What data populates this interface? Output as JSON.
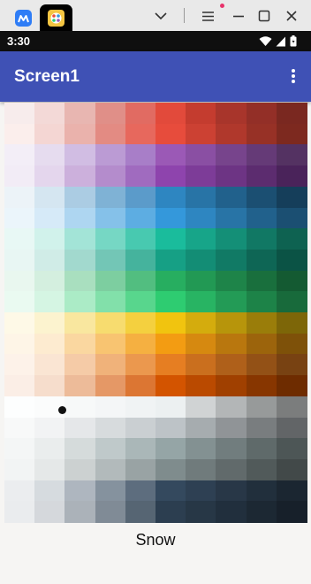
{
  "window": {
    "tabs": [
      {
        "name": "app-tab",
        "icon": "m-logo-icon",
        "active": false
      },
      {
        "name": "palette-tab",
        "icon": "palette-icon",
        "active": true
      }
    ],
    "controls": [
      "chevron-down-icon",
      "menu-icon",
      "minimize-icon",
      "maximize-icon",
      "close-icon"
    ]
  },
  "status_bar": {
    "time": "3:30"
  },
  "app_bar": {
    "title": "Screen1"
  },
  "selected_color_name": "Snow",
  "palette": {
    "rows": [
      [
        "#f7ecec",
        "#f3d9d7",
        "#e8b6b1",
        "#e08f88",
        "#e16b62",
        "#e24a3b",
        "#c43c2f",
        "#a8352b",
        "#932f27",
        "#7a2820"
      ],
      [
        "#fbeeec",
        "#f4d6d3",
        "#eab2ac",
        "#e38b83",
        "#e7685d",
        "#e74c3c",
        "#cc4133",
        "#b0382c",
        "#973126",
        "#7d291f"
      ],
      [
        "#f3eef7",
        "#e6dcef",
        "#d1bde3",
        "#bb9bd4",
        "#a87ec8",
        "#9b59b6",
        "#8a4fa3",
        "#77448c",
        "#653a77",
        "#543262"
      ],
      [
        "#f2ecf6",
        "#e4d6ed",
        "#ccb0dc",
        "#b48ccc",
        "#a06bbf",
        "#8e44ad",
        "#7d3c98",
        "#6d3484",
        "#5c2c6f",
        "#4a235a"
      ],
      [
        "#ecf3f8",
        "#d5e6f1",
        "#abcce3",
        "#7fb2d5",
        "#5b9bca",
        "#2e86c1",
        "#2874a6",
        "#21618c",
        "#1b4f72",
        "#153e5a"
      ],
      [
        "#ebf5fb",
        "#d6eaf8",
        "#aed6f1",
        "#85c1e9",
        "#5dade2",
        "#3498db",
        "#2e86c1",
        "#2874a6",
        "#21618c",
        "#1b4f72"
      ],
      [
        "#e8f8f5",
        "#d1f2eb",
        "#a3e4d7",
        "#76d7c4",
        "#48c9b0",
        "#1abc9c",
        "#17a589",
        "#148f77",
        "#117864",
        "#0e6251"
      ],
      [
        "#e8f6f3",
        "#d0ece7",
        "#a2d9ce",
        "#73c6b6",
        "#45b39d",
        "#16a085",
        "#138d75",
        "#117a65",
        "#0e6655",
        "#0b5345"
      ],
      [
        "#e9f7ef",
        "#d4efdf",
        "#a9dfbf",
        "#7dcea0",
        "#52be80",
        "#27ae60",
        "#229954",
        "#1e8449",
        "#196f3d",
        "#145a32"
      ],
      [
        "#eafaf1",
        "#d5f5e3",
        "#abebc6",
        "#82e0aa",
        "#58d68d",
        "#2ecc71",
        "#28b463",
        "#239b56",
        "#1d8348",
        "#186a3b"
      ],
      [
        "#fef9e7",
        "#fcf3cf",
        "#f9e79f",
        "#f7dc6f",
        "#f4d03f",
        "#f1c40f",
        "#d4ac0d",
        "#b7950b",
        "#9a7d0a",
        "#7d6608"
      ],
      [
        "#fef5e7",
        "#fdebd0",
        "#fad7a0",
        "#f8c471",
        "#f5b041",
        "#f39c12",
        "#d68910",
        "#b9770e",
        "#9c640c",
        "#7e5109"
      ],
      [
        "#fdf2e9",
        "#fae5d3",
        "#f5cba7",
        "#f0b27a",
        "#eb984e",
        "#e67e22",
        "#ca6f1e",
        "#af601a",
        "#935116",
        "#784212"
      ],
      [
        "#fbeee6",
        "#f6ddcc",
        "#edbb99",
        "#e59866",
        "#dc7633",
        "#d35400",
        "#ba4a00",
        "#a04000",
        "#873600",
        "#6e2c00"
      ],
      [
        "#fdfefe",
        "#fbfcfc",
        "#f7f9f9",
        "#f4f6f7",
        "#f0f3f4",
        "#ecf0f1",
        "#d0d3d4",
        "#b3b6b7",
        "#979a9a",
        "#7b7d7d"
      ],
      [
        "#f8f9f9",
        "#f2f3f4",
        "#e5e7e9",
        "#d7dbdd",
        "#cacfd2",
        "#bdc3c7",
        "#a6acaf",
        "#909497",
        "#797d7f",
        "#626567"
      ],
      [
        "#f4f6f6",
        "#eaeded",
        "#d5dbdb",
        "#bfc9ca",
        "#aab7b8",
        "#95a5a6",
        "#839192",
        "#717d7e",
        "#5f6a6a",
        "#4d5656"
      ],
      [
        "#f2f4f4",
        "#e5e8e8",
        "#ccd1d1",
        "#b2babb",
        "#99a3a4",
        "#7f8c8d",
        "#707b7c",
        "#616a6b",
        "#515a5a",
        "#424949"
      ],
      [
        "#ebedef",
        "#d6dbdf",
        "#aeb6bf",
        "#85929e",
        "#5d6d7e",
        "#34495e",
        "#2e4053",
        "#283747",
        "#212f3c",
        "#1b2631"
      ],
      [
        "#eaecee",
        "#d5d8dc",
        "#abb2b9",
        "#808b96",
        "#566573",
        "#2c3e50",
        "#273746",
        "#212f3d",
        "#1c2833",
        "#17202a"
      ]
    ]
  }
}
